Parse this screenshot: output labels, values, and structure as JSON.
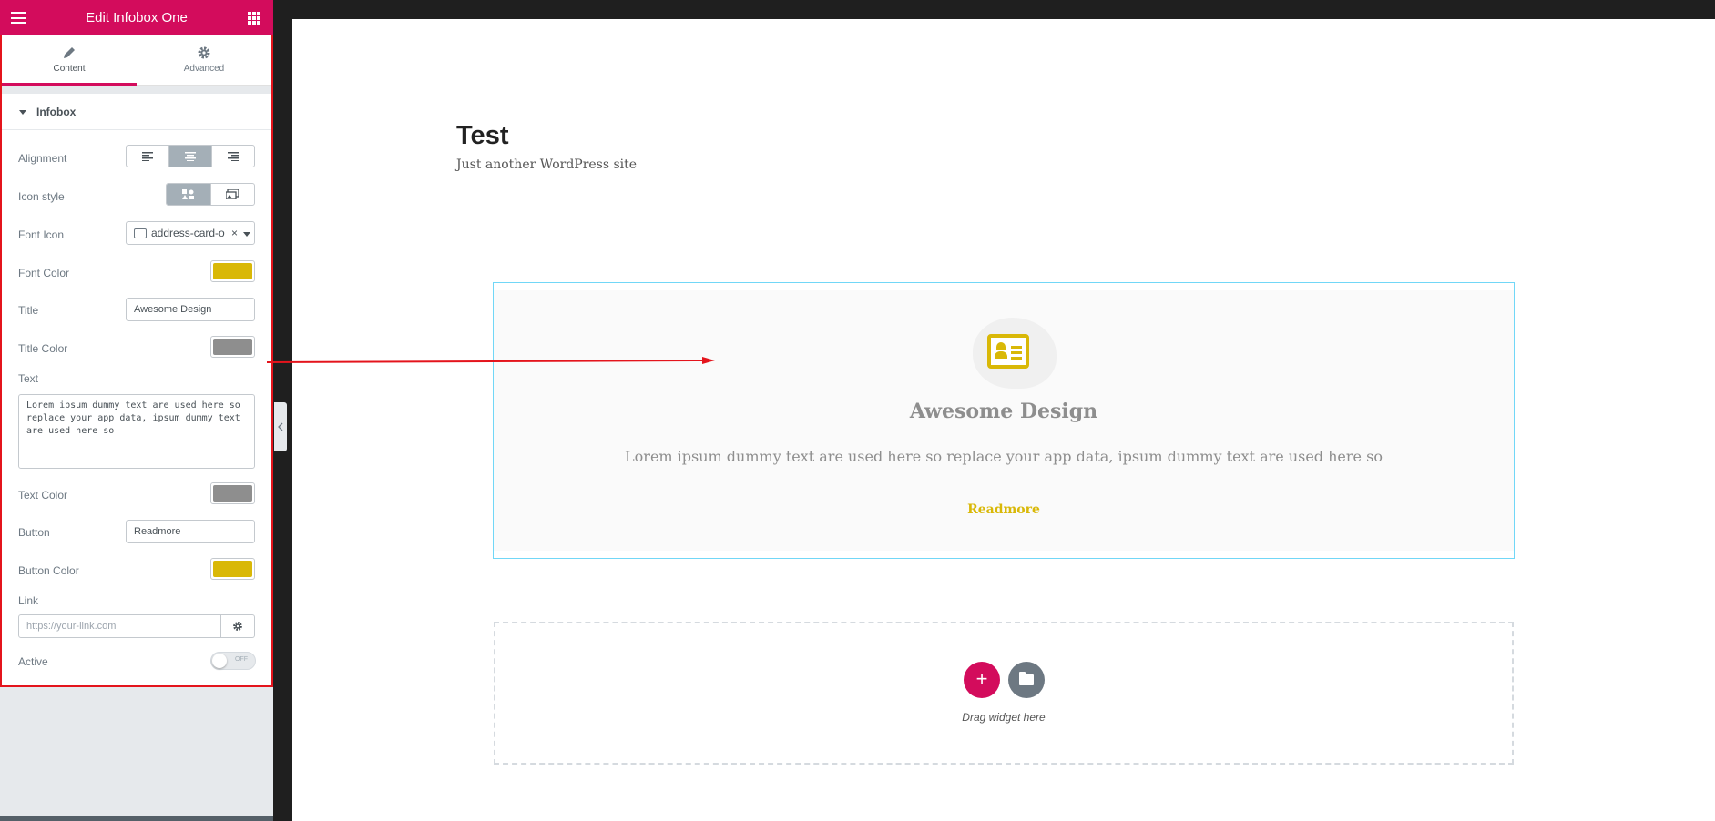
{
  "panel": {
    "title": "Edit Infobox One",
    "tabs": [
      {
        "label": "Content",
        "icon": "pencil-icon",
        "active": true
      },
      {
        "label": "Advanced",
        "icon": "gear-icon",
        "active": false
      }
    ],
    "section": "Infobox",
    "controls": {
      "alignment": {
        "label": "Alignment",
        "selected": "center"
      },
      "icon_style": {
        "label": "Icon style",
        "selected": "icon"
      },
      "font_icon": {
        "label": "Font Icon",
        "value": "address-card-o",
        "clear": "×"
      },
      "font_color": {
        "label": "Font Color",
        "color": "#d9b807"
      },
      "title": {
        "label": "Title",
        "value": "Awesome Design"
      },
      "title_color": {
        "label": "Title Color",
        "color": "#8e8e8e"
      },
      "text": {
        "label": "Text",
        "value": "Lorem ipsum dummy text are used here so replace your app data, ipsum dummy text are used here so"
      },
      "text_color": {
        "label": "Text Color",
        "color": "#8e8e8e"
      },
      "button": {
        "label": "Button",
        "value": "Readmore"
      },
      "button_color": {
        "label": "Button Color",
        "color": "#d9b807"
      },
      "link": {
        "label": "Link",
        "placeholder": "https://your-link.com"
      },
      "active": {
        "label": "Active",
        "state": "OFF"
      }
    }
  },
  "preview": {
    "site_title": "Test",
    "site_tagline": "Just another WordPress site",
    "infobox": {
      "icon": "address-card-icon",
      "title": "Awesome Design",
      "text": "Lorem ipsum dummy text are used here so replace your app data, ipsum dummy text are used here so",
      "button": "Readmore"
    },
    "dropzone": {
      "add": "+",
      "text": "Drag widget here"
    }
  },
  "colors": {
    "brand": "#d30c5c",
    "annotation": "#e4141c",
    "selection": "#71d7f7"
  }
}
